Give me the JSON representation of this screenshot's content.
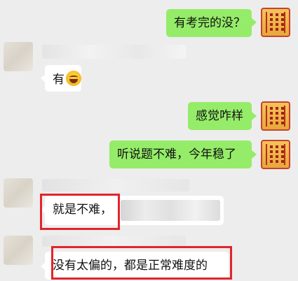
{
  "messages": [
    {
      "side": "out",
      "text": "有考完的没？"
    },
    {
      "side": "in",
      "text": "有",
      "emoji": "laughing-tears-emoji"
    },
    {
      "side": "out",
      "text": "感觉咋样"
    },
    {
      "side": "out",
      "text": "听说题不难，今年稳了"
    },
    {
      "side": "in",
      "text": "就是不难，"
    },
    {
      "side": "in",
      "text": "没有太偏的，都是正常难度的"
    }
  ],
  "colors": {
    "background": "#ededed",
    "outgoing_bubble": "#95ec69",
    "incoming_bubble": "#ffffff",
    "highlight_box": "#e3242b",
    "avatar_border": "#c8412e"
  }
}
